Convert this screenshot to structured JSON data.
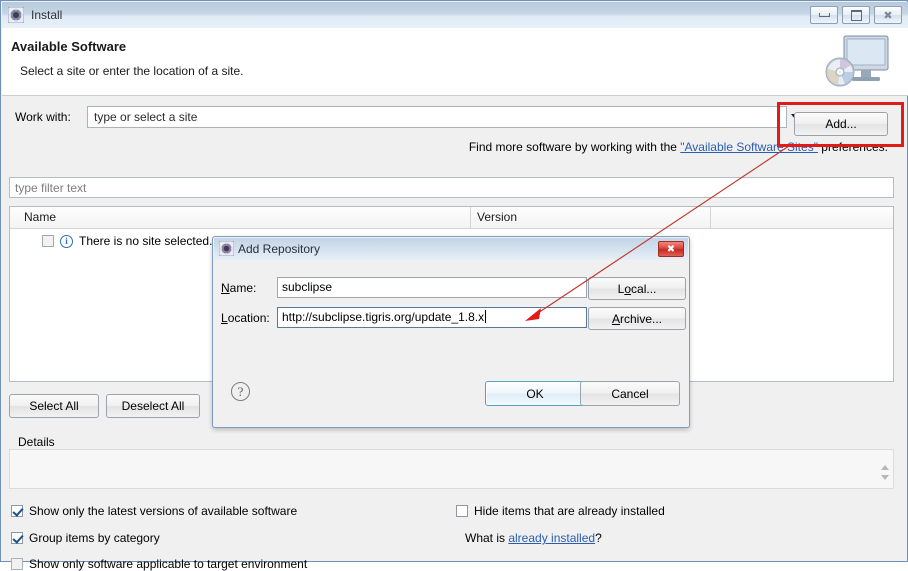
{
  "window": {
    "title": "Install",
    "icon": "install-gear-icon",
    "controls": {
      "minimize": "minimize-icon",
      "maximize": "maximize-icon",
      "close": "close-icon"
    }
  },
  "header": {
    "title": "Available Software",
    "subtitle": "Select a site or enter the location of a site.",
    "icon": "monitor-cd-icon"
  },
  "work_with": {
    "label": "Work with:",
    "value": "",
    "placeholder": "type or select a site",
    "add_button": "Add..."
  },
  "hint": {
    "before": "Find more software by working with the ",
    "link": "\"Available Software Sites\"",
    "after": " preferences."
  },
  "filter": {
    "value": "",
    "placeholder": "type filter text"
  },
  "table": {
    "columns": [
      "Name",
      "Version",
      ""
    ],
    "rows": [
      {
        "checked": false,
        "icon": "info-icon",
        "name": "There is no site selected.",
        "version": ""
      }
    ]
  },
  "selection_buttons": {
    "select_all": "Select All",
    "deselect_all": "Deselect All"
  },
  "details": {
    "label": "Details",
    "value": ""
  },
  "options": {
    "show_latest": {
      "label": "Show only the latest versions of available software",
      "checked": true
    },
    "group_category": {
      "label": "Group items by category",
      "checked": true
    },
    "target_env": {
      "label": "Show only software applicable to target environment",
      "checked": false
    },
    "hide_installed": {
      "label": "Hide items that are already installed",
      "checked": false
    },
    "what_is": {
      "before": "What is ",
      "link": "already installed",
      "after": "?"
    }
  },
  "add_repository": {
    "title": "Add Repository",
    "icon": "install-gear-icon",
    "close": "close-icon",
    "name_label": "Name:",
    "name_mnemonic": "N",
    "name_value": "subclipse",
    "location_label": "Location:",
    "location_mnemonic": "L",
    "location_value": "http://subclipse.tigris.org/update_1.8.x",
    "local_button": "Local...",
    "local_mnemonic": "o",
    "archive_button": "Archive...",
    "archive_mnemonic": "A",
    "help_icon": "question-mark-icon",
    "ok_button": "OK",
    "cancel_button": "Cancel"
  },
  "annotations": {
    "highlight_color": "#e01b18",
    "arrow_color": "#c0392b",
    "highlight_target": "add-button",
    "arrow_target": "location-input"
  }
}
